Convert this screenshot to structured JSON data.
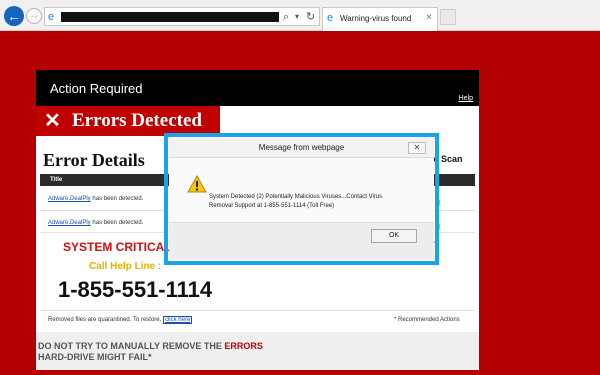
{
  "browser": {
    "back_icon": "back-arrow-icon",
    "forward_icon": "forward-arrow-icon",
    "address_bar": {
      "favicon": "ie-page-icon",
      "search_icon": "search-icon",
      "dropdown_icon": "chevron-down-icon",
      "refresh_icon": "refresh-icon"
    },
    "tab": {
      "icon": "ie-page-icon",
      "label": "Warning-virus found",
      "close_glyph": "×"
    }
  },
  "page": {
    "background_color": "#b30000",
    "header": {
      "title": "Action Required",
      "help_link": "Help"
    },
    "banner": {
      "icon": "x-mark-icon",
      "text": "Errors Detected"
    },
    "section_title": "Error Details",
    "online_scan_label": "ne Scan",
    "table": {
      "column_header": "Title",
      "rows": [
        {
          "link": "Adware.DealPly",
          "text": " has been detected."
        },
        {
          "link": "Adware.DealPly",
          "text": " has been detected."
        }
      ]
    },
    "alert": {
      "headline": "SYSTEM CRITICAL",
      "call_label": "Call Help Line :",
      "phone": "1-855-551-1114"
    },
    "quarantine_text": "Removed files are quarantined. To restore, ",
    "quarantine_link": "click here",
    "recommended_text": "* Recommended Actions",
    "warning": {
      "line1_prefix": "DO NOT TRY TO MANUALLY REMOVE THE ",
      "line1_highlight": "ERRORS",
      "line2": "HARD-DRIVE MIGHT FAIL*"
    },
    "bleed_text": {
      "rt1": "rt",
      "rt2": "rt",
      "y": "y"
    }
  },
  "dialog": {
    "title": "Message from webpage",
    "close_glyph": "✕",
    "icon": "warning-triangle-icon",
    "message_line1": "System Detected (2) Potentially Malicious Viruses...Contact Virus",
    "message_line2": "Removal Support at 1-855-551-1114 (Toll Free)",
    "ok_label": "OK",
    "highlight_color": "#1aa3e8"
  }
}
